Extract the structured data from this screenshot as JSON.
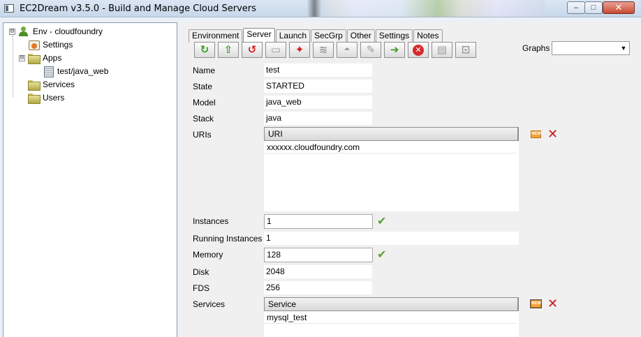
{
  "window": {
    "title": "EC2Dream v3.5.0 - Build and Manage Cloud Servers",
    "minimize_glyph": "–",
    "maximize_glyph": "□",
    "close_glyph": "✕"
  },
  "tree": {
    "root": {
      "label": "Env - cloudfoundry",
      "expander": "⊟",
      "icon": "person-icon"
    },
    "items": [
      {
        "label": "Settings",
        "icon": "settings-icon"
      },
      {
        "label": "Apps",
        "icon": "folder-icon",
        "expander": "⊟"
      },
      {
        "label": "test/java_web",
        "icon": "document-icon"
      },
      {
        "label": "Services",
        "icon": "folder-icon"
      },
      {
        "label": "Users",
        "icon": "folder-icon"
      }
    ]
  },
  "tabs": [
    {
      "label": "Environment",
      "active": false
    },
    {
      "label": "Server",
      "active": true
    },
    {
      "label": "Launch",
      "active": false
    },
    {
      "label": "SecGrp",
      "active": false
    },
    {
      "label": "Other",
      "active": false
    },
    {
      "label": "Settings",
      "active": false
    },
    {
      "label": "Notes",
      "active": false
    }
  ],
  "toolbar": {
    "buttons": [
      {
        "icon": "refresh-icon",
        "glyph": "↻"
      },
      {
        "icon": "up-arrow-icon",
        "glyph": "⇧"
      },
      {
        "icon": "restart-icon",
        "glyph": "↺"
      },
      {
        "icon": "terminal-icon",
        "glyph": "▭"
      },
      {
        "icon": "debug-icon",
        "glyph": "✦"
      },
      {
        "icon": "logs-icon",
        "glyph": "≋"
      },
      {
        "icon": "crash-icon",
        "glyph": "◓"
      },
      {
        "icon": "tools-icon",
        "glyph": "✎"
      },
      {
        "icon": "start-arrow-icon",
        "glyph": "➜"
      },
      {
        "icon": "stop-icon",
        "glyph": "✕"
      },
      {
        "icon": "files-icon",
        "glyph": "▤"
      },
      {
        "icon": "config-icon",
        "glyph": "⊡"
      }
    ]
  },
  "graphs": {
    "label": "Graphs",
    "value": "",
    "arrow": "▼"
  },
  "fields": {
    "name": {
      "label": "Name",
      "value": "test"
    },
    "state": {
      "label": "State",
      "value": "STARTED"
    },
    "model": {
      "label": "Model",
      "value": "java_web"
    },
    "stack": {
      "label": "Stack",
      "value": "java"
    },
    "uris": {
      "label": "URIs",
      "column": "URI",
      "rows": [
        "xxxxxx.cloudfoundry.com"
      ]
    },
    "instances": {
      "label": "Instances",
      "value": "1"
    },
    "running_instances": {
      "label": "Running Instances",
      "value": "1"
    },
    "memory": {
      "label": "Memory",
      "value": "128"
    },
    "disk": {
      "label": "Disk",
      "value": "2048"
    },
    "fds": {
      "label": "FDS",
      "value": "256"
    },
    "services": {
      "label": "Services",
      "column": "Service",
      "rows": [
        "mysql_test"
      ]
    }
  },
  "icons": {
    "check": "✔",
    "new": "NEW",
    "delete": "✕"
  },
  "colors": {
    "accent_green": "#3e9a1e",
    "delete_red": "#c91414",
    "new_orange": "#f2a33a"
  }
}
